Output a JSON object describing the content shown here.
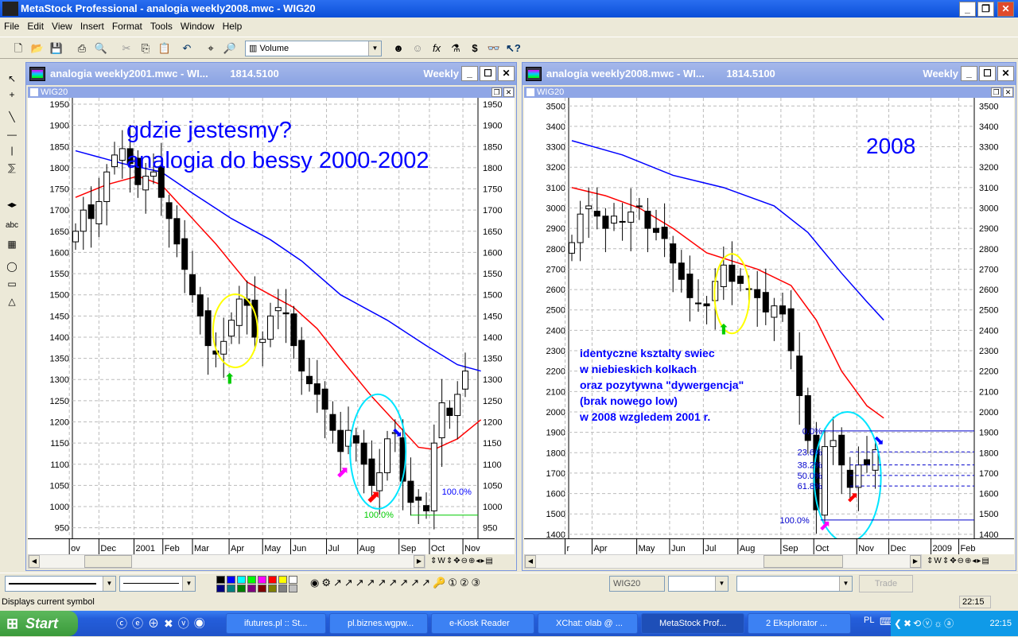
{
  "app": {
    "title": "MetaStock Professional - analogia weekly2008.mwc - WIG20",
    "icon_text": "MS"
  },
  "menu": [
    "File",
    "Edit",
    "View",
    "Insert",
    "Format",
    "Tools",
    "Window",
    "Help"
  ],
  "toolbar": {
    "indicator_select": "Volume"
  },
  "windows": [
    {
      "title": "analogia weekly2001.mwc - WI...",
      "price": "1814.5100",
      "period": "Weekly",
      "symbol": "WIG20",
      "y_ticks": [
        950,
        1000,
        1050,
        1100,
        1150,
        1200,
        1250,
        1300,
        1350,
        1400,
        1450,
        1500,
        1550,
        1600,
        1650,
        1700,
        1750,
        1800,
        1850,
        1900,
        1950
      ],
      "ylim": [
        925,
        1965
      ],
      "x_labels": [
        {
          "i": -0.8,
          "t": "ov"
        },
        {
          "i": 3,
          "t": "Dec"
        },
        {
          "i": 7.5,
          "t": "2001"
        },
        {
          "i": 11.2,
          "t": "Feb"
        },
        {
          "i": 15,
          "t": "Mar"
        },
        {
          "i": 19.7,
          "t": "Apr"
        },
        {
          "i": 24,
          "t": "May"
        },
        {
          "i": 27.6,
          "t": "Jun"
        },
        {
          "i": 32.2,
          "t": "Jul"
        },
        {
          "i": 36.2,
          "t": "Aug"
        },
        {
          "i": 41.5,
          "t": "Sep"
        },
        {
          "i": 45.4,
          "t": "Oct"
        },
        {
          "i": 49.7,
          "t": "Nov"
        }
      ],
      "closes": [
        1650,
        1700,
        1680,
        1720,
        1790,
        1830,
        1845,
        1810,
        1760,
        1780,
        1790,
        1730,
        1680,
        1620,
        1560,
        1500,
        1450,
        1380,
        1360,
        1390,
        1440,
        1490,
        1475,
        1400,
        1395,
        1450,
        1470,
        1455,
        1380,
        1320,
        1290,
        1265,
        1230,
        1180,
        1130,
        1180,
        1150,
        1100,
        1050,
        1080,
        1160,
        1175,
        1060,
        1010,
        1015,
        990,
        1150,
        1245,
        1215,
        1265,
        1320
      ],
      "ma_red": [
        [
          0,
          1730
        ],
        [
          4,
          1760
        ],
        [
          8,
          1780
        ],
        [
          11,
          1760
        ],
        [
          14,
          1700
        ],
        [
          18,
          1620
        ],
        [
          22,
          1530
        ],
        [
          25,
          1500
        ],
        [
          28,
          1470
        ],
        [
          31,
          1420
        ],
        [
          34,
          1350
        ],
        [
          38,
          1260
        ],
        [
          41,
          1200
        ],
        [
          44,
          1140
        ],
        [
          46,
          1135
        ],
        [
          49,
          1160
        ],
        [
          52,
          1205
        ]
      ],
      "ma_blue": [
        [
          0,
          1840
        ],
        [
          6,
          1810
        ],
        [
          11,
          1790
        ],
        [
          15,
          1740
        ],
        [
          20,
          1680
        ],
        [
          25,
          1630
        ],
        [
          29,
          1580
        ],
        [
          34,
          1500
        ],
        [
          40,
          1440
        ],
        [
          45,
          1380
        ],
        [
          49,
          1335
        ],
        [
          52,
          1320
        ]
      ],
      "annotation_title": [
        "gdzie jestesmy?",
        "analogia do bessy 2000-2002"
      ],
      "fib_labels": {
        "top": "100.0%",
        "bottom": "100.0%"
      }
    },
    {
      "title": "analogia weekly2008.mwc - WI...",
      "price": "1814.5100",
      "period": "Weekly",
      "symbol": "WIG20",
      "y_ticks": [
        1400,
        1500,
        1600,
        1700,
        1800,
        1900,
        2000,
        2100,
        2200,
        2300,
        2400,
        2500,
        2600,
        2700,
        2800,
        2900,
        3000,
        3100,
        3200,
        3300,
        3400,
        3500
      ],
      "ylim": [
        1380,
        3540
      ],
      "x_labels": [
        {
          "i": -0.8,
          "t": "r"
        },
        {
          "i": 2.4,
          "t": "Apr"
        },
        {
          "i": 7.7,
          "t": "May"
        },
        {
          "i": 11.6,
          "t": "Jun"
        },
        {
          "i": 15.6,
          "t": "Jul"
        },
        {
          "i": 19.7,
          "t": "Aug"
        },
        {
          "i": 24.8,
          "t": "Sep"
        },
        {
          "i": 28.7,
          "t": "Oct"
        },
        {
          "i": 33.8,
          "t": "Nov"
        },
        {
          "i": 37.6,
          "t": "Dec"
        },
        {
          "i": 42.6,
          "t": "2009"
        },
        {
          "i": 45.9,
          "t": "Feb"
        }
      ],
      "closes": [
        2830,
        2970,
        3010,
        2960,
        2900,
        2960,
        2930,
        2980,
        3010,
        2900,
        2880,
        2850,
        2730,
        2650,
        2560,
        2530,
        2520,
        2640,
        2720,
        2640,
        2630,
        2600,
        2560,
        2490,
        2520,
        2480,
        2300,
        2080,
        1860,
        1520,
        1830,
        1860,
        1740,
        1630,
        1740,
        1740,
        1815
      ],
      "ma_red": [
        [
          0,
          3100
        ],
        [
          4,
          3060
        ],
        [
          8,
          3000
        ],
        [
          12,
          2900
        ],
        [
          16,
          2780
        ],
        [
          19,
          2740
        ],
        [
          22,
          2700
        ],
        [
          26,
          2620
        ],
        [
          29,
          2450
        ],
        [
          32,
          2200
        ],
        [
          35,
          2030
        ],
        [
          37,
          1970
        ]
      ],
      "ma_blue": [
        [
          0,
          3330
        ],
        [
          6,
          3260
        ],
        [
          12,
          3160
        ],
        [
          18,
          3100
        ],
        [
          24,
          3010
        ],
        [
          28,
          2880
        ],
        [
          32,
          2680
        ],
        [
          35,
          2540
        ],
        [
          37,
          2450
        ]
      ],
      "annotation_title": [
        "2008"
      ],
      "note": [
        "identyczne ksztalty swiec",
        "w niebieskich kolkach",
        "oraz pozytywna \"dywergencja\"",
        "(brak nowego low)",
        "w 2008 wzgledem 2001 r."
      ],
      "fib": {
        "high": 1907,
        "low": 1470,
        "levels": [
          {
            "p": 0,
            "t": "0.0%"
          },
          {
            "p": 0.236,
            "t": "23.6%"
          },
          {
            "p": 0.382,
            "t": "38.2%"
          },
          {
            "p": 0.5,
            "t": "50.0%"
          },
          {
            "p": 0.618,
            "t": "61.8%"
          },
          {
            "p": 1,
            "t": "100.0%"
          }
        ]
      }
    }
  ],
  "bottombar": {
    "symbol": "WIG20",
    "trade": "Trade",
    "palette": [
      "#000000",
      "#0000ff",
      "#00ffff",
      "#00ff00",
      "#ff00ff",
      "#ff0000",
      "#ffff00",
      "#ffffff",
      "#000080",
      "#008080",
      "#008000",
      "#800080",
      "#800000",
      "#808000",
      "#808080",
      "#c0c0c0"
    ]
  },
  "status": {
    "text": "Displays current symbol",
    "time": "22:15"
  },
  "taskbar": {
    "start": "Start",
    "tasks": [
      "ifutures.pl :: St...",
      "pl.biznes.wgpw...",
      "e-Kiosk Reader",
      "XChat: olab @ ...",
      "MetaStock Prof...",
      "2 Eksplorator ..."
    ],
    "lang": "PL",
    "clock": "22:15"
  },
  "colors": {
    "ma_red": "#ff0000",
    "ma_blue": "#0000ff",
    "note": "#0000ff",
    "ellipse_yellow": "#ffff00",
    "ellipse_cyan": "#00e5ff"
  }
}
